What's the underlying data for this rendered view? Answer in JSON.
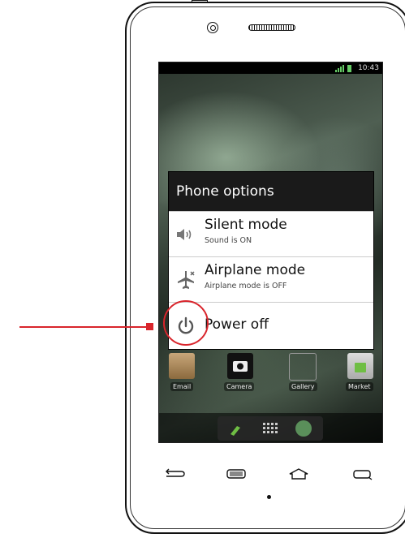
{
  "statusbar": {
    "time": "10:43",
    "icons": [
      "signal-icon",
      "battery-icon"
    ]
  },
  "dialog": {
    "title": "Phone options",
    "options": [
      {
        "label": "Silent mode",
        "sublabel": "Sound is ON",
        "icon": "speaker-icon"
      },
      {
        "label": "Airplane mode",
        "sublabel": "Airplane mode is OFF",
        "icon": "airplane-icon"
      },
      {
        "label": "Power off",
        "sublabel": "",
        "icon": "power-icon"
      }
    ]
  },
  "home": {
    "apps": [
      {
        "label": "Email",
        "icon": "email-icon"
      },
      {
        "label": "Camera",
        "icon": "camera-icon"
      },
      {
        "label": "Gallery",
        "icon": "gallery-icon"
      },
      {
        "label": "Market",
        "icon": "market-icon"
      }
    ]
  },
  "hardware_buttons": [
    "back-button",
    "menu-button",
    "home-button",
    "search-button"
  ],
  "annotation": {
    "color": "#d9252c",
    "target": "Power off"
  }
}
